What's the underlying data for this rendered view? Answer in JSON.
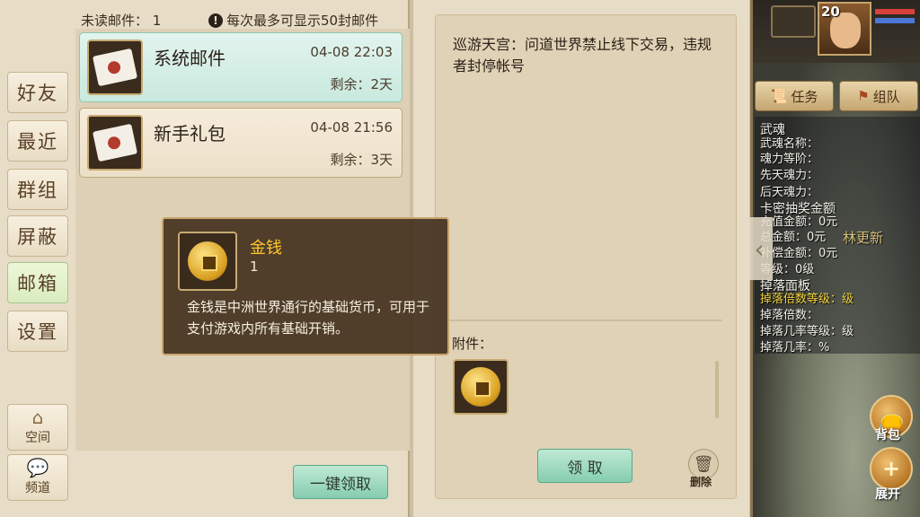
{
  "mailbox": {
    "unread_label": "未读邮件：",
    "unread_count": "1",
    "warning_text": "每次最多可显示50封邮件"
  },
  "nav": {
    "items": [
      {
        "label": "好友"
      },
      {
        "label": "最近"
      },
      {
        "label": "群组"
      },
      {
        "label": "屏蔽"
      },
      {
        "label": "邮箱"
      },
      {
        "label": "设置"
      }
    ],
    "space_label": "空间",
    "channel_label": "频道"
  },
  "mails": [
    {
      "title": "系统邮件",
      "date": "04-08 22:03",
      "remaining": "剩余：2天"
    },
    {
      "title": "新手礼包",
      "date": "04-08 21:56",
      "remaining": "剩余：3天"
    }
  ],
  "claim_all_label": "一键领取",
  "detail": {
    "body": "巡游天宫：问道世界禁止线下交易，违规者封停帐号",
    "attachment_label": "附件：",
    "claim_label": "领 取",
    "delete_label": "删除"
  },
  "tooltip": {
    "name": "金钱",
    "quantity": "1",
    "description": "金钱是中洲世界通行的基础货币，可用于支付游戏内所有基础开销。"
  },
  "game": {
    "level": "20",
    "task_label": "任务",
    "team_label": "组队",
    "npc_name": "林更新",
    "bag_label": "背包",
    "expand_label": "展开",
    "info_lines": [
      "武魂",
      "武魂名称：",
      "魂力等阶：",
      "先天魂力：",
      "后天魂力：",
      "卡密抽奖金额",
      "充值金额：0元",
      "总金额：0元",
      "补偿金额：0元",
      "等级：0级",
      "掉落面板",
      "掉落倍数等级：级",
      "掉落倍数：",
      "掉落几率等级：级",
      "掉落几率：%"
    ]
  },
  "colors": {
    "accent_green": "#86cdb0",
    "tooltip_title": "#ffc629",
    "panel_bg": "#e7dcc6"
  }
}
